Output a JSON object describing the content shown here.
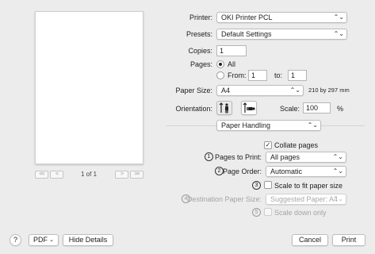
{
  "preview": {
    "page_indicator": "1 of 1",
    "first_label": "<<",
    "prev_label": "<",
    "next_label": ">",
    "last_label": ">>"
  },
  "printer": {
    "label": "Printer:",
    "value": "OKI Printer PCL"
  },
  "presets": {
    "label": "Presets:",
    "value": "Default Settings"
  },
  "copies": {
    "label": "Copies:",
    "value": "1"
  },
  "pages": {
    "label": "Pages:",
    "all_label": "All",
    "from_label": "From:",
    "from_value": "1",
    "to_label": "to:",
    "to_value": "1",
    "selected": "All"
  },
  "paper_size": {
    "label": "Paper Size:",
    "value": "A4",
    "dimensions": "210 by 297 mm"
  },
  "orientation": {
    "label": "Orientation:",
    "selected": "portrait"
  },
  "scale": {
    "label": "Scale:",
    "value": "100",
    "unit": "%"
  },
  "section_popup": {
    "value": "Paper Handling"
  },
  "paper_handling": {
    "collate": {
      "label": "Collate pages",
      "checked": true
    },
    "pages_to_print": {
      "marker": "1",
      "label": "Pages to Print:",
      "value": "All pages"
    },
    "page_order": {
      "marker": "2",
      "label": "Page Order:",
      "value": "Automatic"
    },
    "scale_to_fit": {
      "marker": "3",
      "label": "Scale to fit paper size",
      "checked": false
    },
    "destination_paper_size": {
      "marker": "4",
      "label": "Destination Paper Size:",
      "value": "Suggested Paper: A4"
    },
    "scale_down_only": {
      "marker": "5",
      "label": "Scale down only",
      "checked": false
    }
  },
  "footer": {
    "help_label": "?",
    "pdf_label": "PDF",
    "hide_details_label": "Hide Details",
    "cancel_label": "Cancel",
    "print_label": "Print"
  },
  "icons": {
    "stepper": "updown-chevron-icon",
    "check": "checkmark-icon",
    "pdf_menu": "chevron-down-icon"
  }
}
